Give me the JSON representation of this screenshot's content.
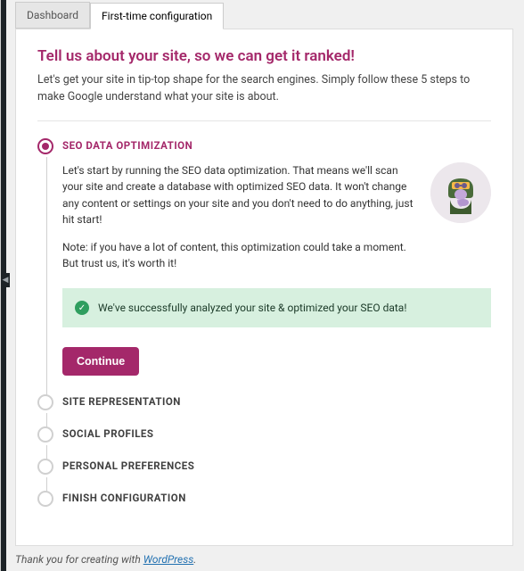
{
  "tabs": {
    "dashboard": "Dashboard",
    "config": "First-time configuration"
  },
  "card": {
    "title": "Tell us about your site, so we can get it ranked!",
    "subtitle": "Let's get your site in tip-top shape for the search engines. Simply follow these 5 steps to make Google understand what your site is about."
  },
  "steps": {
    "seo": {
      "title": "SEO DATA OPTIMIZATION",
      "para1": "Let's start by running the SEO data optimization. That means we'll scan your site and create a database with optimized SEO data. It won't change any content or settings on your site and you don't need to do anything, just hit start!",
      "para2": "Note: if you have a lot of content, this optimization could take a moment. But trust us, it's worth it!",
      "success": "We've successfully analyzed your site & optimized your SEO data!",
      "continue": "Continue"
    },
    "site_representation": "SITE REPRESENTATION",
    "social_profiles": "SOCIAL PROFILES",
    "personal_preferences": "PERSONAL PREFERENCES",
    "finish_configuration": "FINISH CONFIGURATION"
  },
  "footer": {
    "thank_text": "Thank you for creating with ",
    "link_text": "WordPress",
    "period": "."
  }
}
